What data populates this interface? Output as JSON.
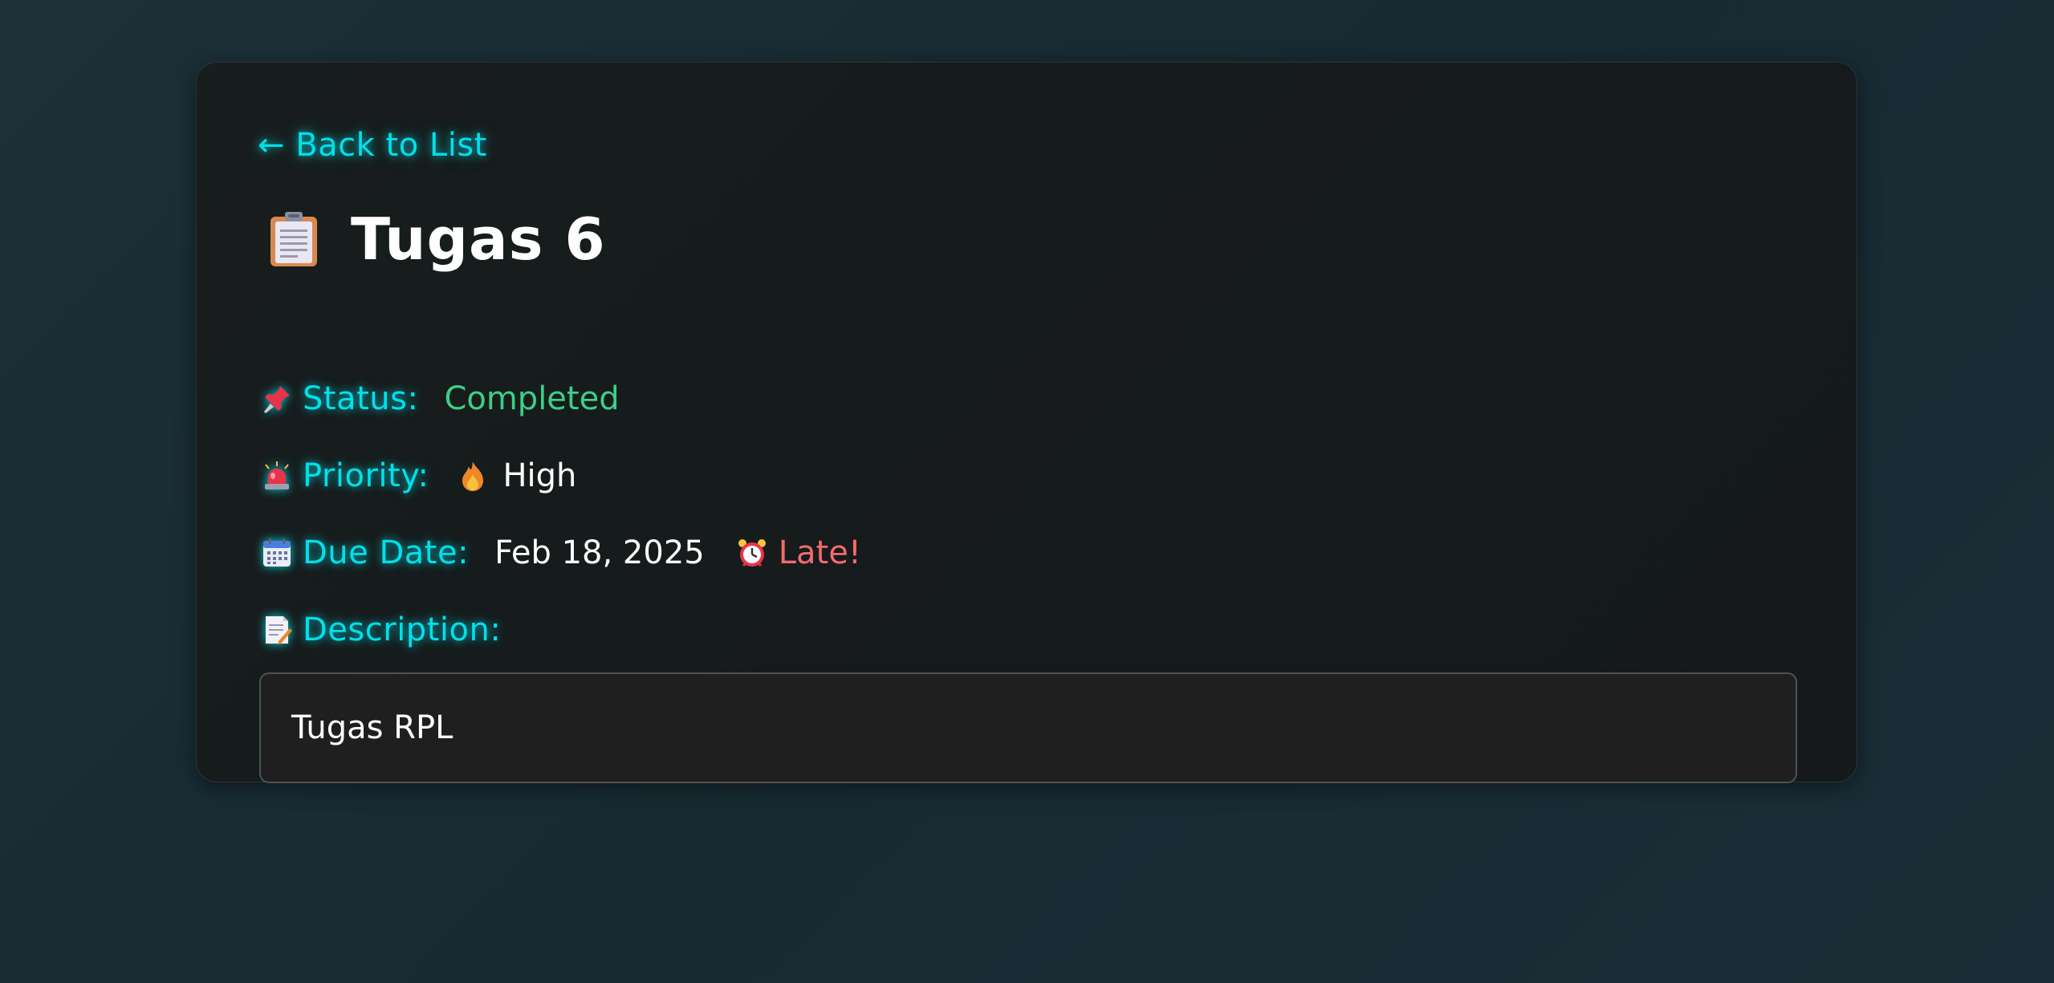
{
  "nav": {
    "back_label": "← Back to List"
  },
  "task": {
    "title_icon": "clipboard-icon",
    "title": "Tugas 6",
    "status": {
      "icon": "pushpin-icon",
      "label": "Status:",
      "value": "Completed",
      "color": "#3ccf88"
    },
    "priority": {
      "icon": "siren-icon",
      "label": "Priority:",
      "value_icon": "fire-icon",
      "value": "High"
    },
    "due_date": {
      "icon": "calendar-icon",
      "label": "Due Date:",
      "value": "Feb 18, 2025",
      "late_icon": "alarm-clock-icon",
      "late_text": "Late!",
      "late_color": "#f26b6b"
    },
    "description": {
      "icon": "memo-icon",
      "label": "Description:",
      "value": "Tugas RPL"
    }
  },
  "theme": {
    "accent": "#00e0ea",
    "card_bg": "#171c1d",
    "page_bg": "#1b2e36"
  }
}
